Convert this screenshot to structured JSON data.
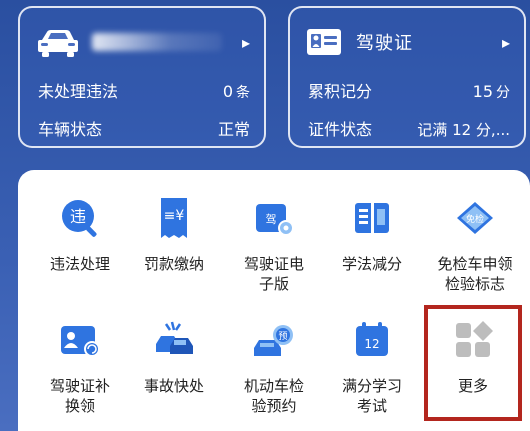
{
  "vehicle_card": {
    "row1_label": "未处理违法",
    "row1_value": "0",
    "row1_unit": "条",
    "row2_label": "车辆状态",
    "row2_value": "正常"
  },
  "license_card": {
    "title": "驾驶证",
    "row1_label": "累积记分",
    "row1_value": "15",
    "row1_unit": "分",
    "row2_label": "证件状态",
    "row2_value": "记满 12 分,..."
  },
  "services": [
    {
      "label": "违法处理",
      "icon": "violation-icon"
    },
    {
      "label": "罚款缴纳",
      "icon": "fine-payment-icon"
    },
    {
      "label": "驾驶证电\n子版",
      "icon": "e-license-icon"
    },
    {
      "label": "学法减分",
      "icon": "study-book-icon"
    },
    {
      "label": "免检车申领\n检验标志",
      "icon": "exempt-inspection-icon",
      "badge": "免检"
    },
    {
      "label": "驾驶证补\n换领",
      "icon": "license-renew-icon"
    },
    {
      "label": "事故快处",
      "icon": "accident-icon"
    },
    {
      "label": "机动车检\n验预约",
      "icon": "inspection-booking-icon",
      "badge": "预"
    },
    {
      "label": "满分学习\n考试",
      "icon": "calendar-exam-icon",
      "badge": "12"
    },
    {
      "label": "更多",
      "icon": "more-grid-icon"
    }
  ],
  "colors": {
    "header_bg": "#2f55a8",
    "icon_blue": "#2f74e0",
    "icon_light": "#8fc0f5",
    "highlight": "#b3261e"
  }
}
